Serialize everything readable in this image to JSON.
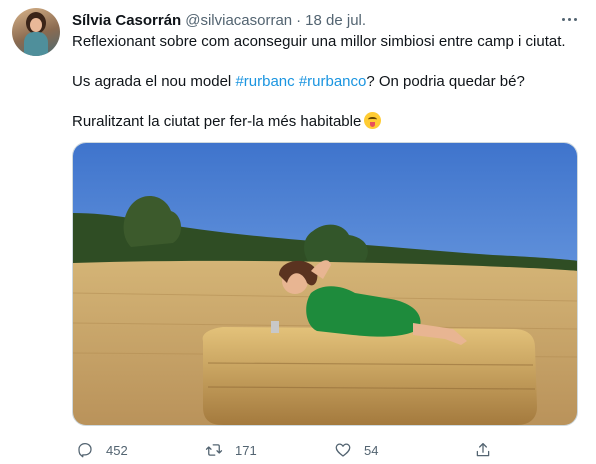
{
  "author": {
    "name": "Sílvia Casorrán",
    "handle": "@silviacasorran",
    "separator": "·",
    "date": "18 de jul."
  },
  "tweet": {
    "line1": "Reflexionant sobre com aconseguir una millor simbiosi entre camp i ciutat.",
    "line2_prefix": "Us agrada el nou model ",
    "hashtag1": "#rurbanc",
    "hashtag2": "#rurbanco",
    "line2_suffix": "? On podria quedar bé?",
    "line3": "Ruralitzant la ciutat per fer-la més habitable",
    "emoji": "squinting-face-with-tongue"
  },
  "photo": {
    "subject": "woman in green dress lying on a hay bale in a harvested field",
    "sky_color": "#5b8fd8",
    "field_color": "#c9a567"
  },
  "actions": {
    "reply_count": "452",
    "retweet_count": "171",
    "like_count": "54",
    "share_icon": "share-icon"
  },
  "colors": {
    "text": "#0f1419",
    "secondary": "#536471",
    "hashtag": "#1b95e0"
  }
}
